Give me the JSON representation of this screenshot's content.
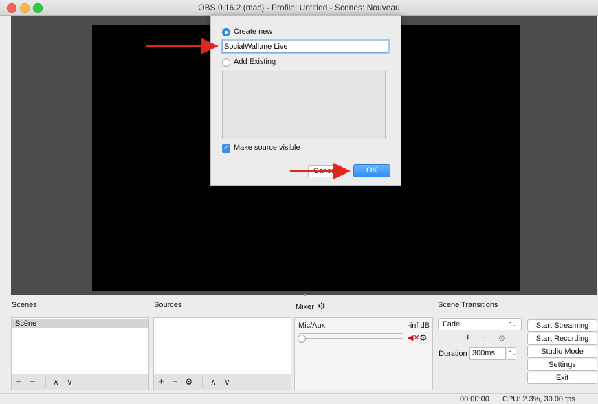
{
  "window": {
    "title": "OBS 0.16.2 (mac) - Profile: Untitled - Scenes: Nouveau"
  },
  "dialog": {
    "create_new_label": "Create new",
    "name_value": "SocialWall.me Live",
    "add_existing_label": "Add Existing",
    "make_visible_label": "Make source visible",
    "cancel_label": "Cancel",
    "ok_label": "OK"
  },
  "scenes": {
    "title": "Scenes",
    "items": [
      "Scène"
    ]
  },
  "sources": {
    "title": "Sources"
  },
  "mixer": {
    "title": "Mixer",
    "channel": "Mic/Aux",
    "level": "-inf dB",
    "volume_fraction": 0
  },
  "transitions": {
    "title": "Scene Transitions",
    "selected": "Fade",
    "duration_label": "Duration",
    "duration_value": "300ms"
  },
  "controls": {
    "start_streaming": "Start Streaming",
    "start_recording": "Start Recording",
    "studio_mode": "Studio Mode",
    "settings": "Settings",
    "exit": "Exit"
  },
  "status": {
    "time": "00:00:00",
    "cpu": "CPU: 2.3%, 30.00 fps"
  },
  "colors": {
    "accent": "#3b8fe8",
    "arrow": "#e0271f",
    "mute": "#d0021b"
  },
  "icons": [
    "gear-icon",
    "plus-icon",
    "minus-icon",
    "chevron-up-icon",
    "chevron-down-icon",
    "mute-icon"
  ]
}
